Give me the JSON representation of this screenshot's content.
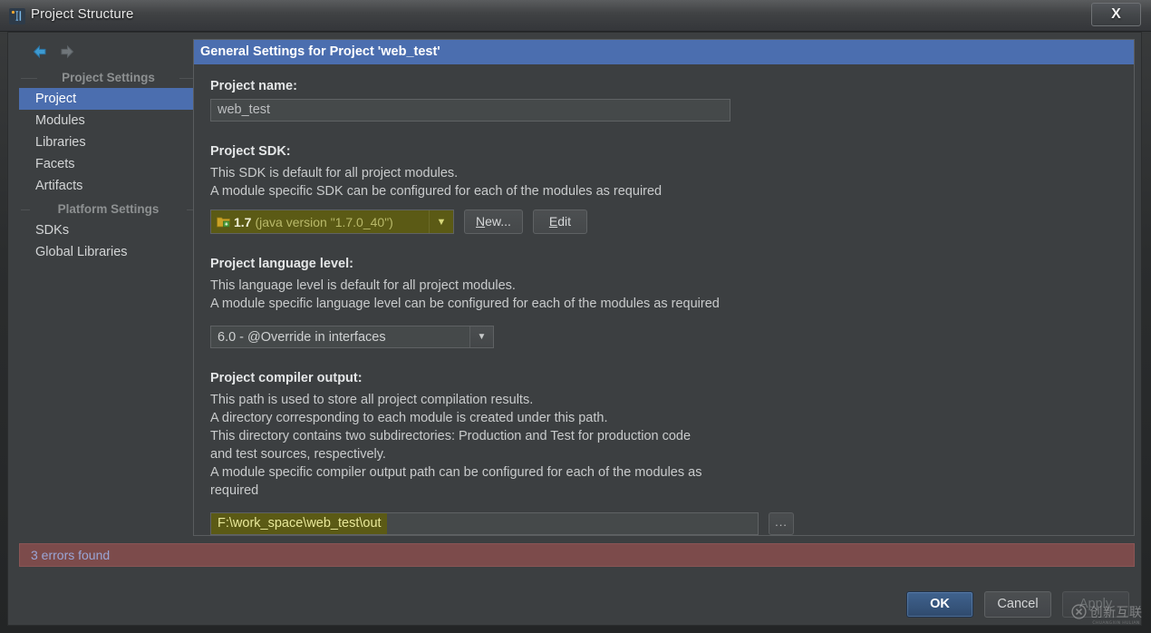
{
  "window": {
    "title": "Project Structure",
    "icon": "intellij-idea-icon",
    "close_label": "X"
  },
  "sidebar": {
    "nav": {
      "back_icon": "arrow-left-icon",
      "forward_icon": "arrow-right-icon"
    },
    "groups": [
      {
        "title": "Project Settings",
        "items": [
          {
            "label": "Project",
            "selected": true
          },
          {
            "label": "Modules",
            "selected": false
          },
          {
            "label": "Libraries",
            "selected": false
          },
          {
            "label": "Facets",
            "selected": false
          },
          {
            "label": "Artifacts",
            "selected": false
          }
        ]
      },
      {
        "title": "Platform Settings",
        "items": [
          {
            "label": "SDKs",
            "selected": false
          },
          {
            "label": "Global Libraries",
            "selected": false
          }
        ]
      }
    ]
  },
  "main": {
    "panel_title": "General Settings for Project 'web_test'",
    "project_name": {
      "label": "Project name:",
      "value": "web_test",
      "placeholder": ""
    },
    "project_sdk": {
      "label": "Project SDK:",
      "description": [
        "This SDK is default for all project modules.",
        "A module specific SDK can be configured for each of the modules as required"
      ],
      "sdk_icon": "folder-jdk-icon",
      "sdk_name": "1.7",
      "sdk_version": "(java version \"1.7.0_40\")",
      "dropdown_icon": "chevron-down-icon",
      "new_button": {
        "mnemonic": "N",
        "rest": "ew..."
      },
      "edit_button": {
        "mnemonic": "E",
        "rest": "dit"
      }
    },
    "language_level": {
      "label": "Project language level:",
      "description": [
        "This language level is default for all project modules.",
        "A module specific language level can be configured for each of the modules as required"
      ],
      "value": "6.0 - @Override in interfaces",
      "dropdown_icon": "chevron-down-icon"
    },
    "compiler_output": {
      "label": "Project compiler output:",
      "description": [
        "This path is used to store all project compilation results.",
        "A directory corresponding to each module is created under this path.",
        "This directory contains two subdirectories: Production and Test for production code",
        "and test sources, respectively.",
        "A module specific compiler output path can be configured for each of the modules as",
        "required"
      ],
      "value": "F:\\work_space\\web_test\\out",
      "browse_label": "...",
      "browse_icon": "ellipsis-icon"
    }
  },
  "status": {
    "error_text": "3 errors found"
  },
  "footer": {
    "ok_label": "OK",
    "cancel_label": "Cancel",
    "apply_label": "Apply"
  },
  "watermark": {
    "main": "创新互联",
    "sub": "CHUANGXIN HULIAN"
  },
  "colors": {
    "accent_blue": "#4b6eaf",
    "dialog_bg": "#3c3f41",
    "highlight_olive": "#5b5a15",
    "error_bg": "#7c4b4b",
    "error_text": "#9aa6d6"
  }
}
